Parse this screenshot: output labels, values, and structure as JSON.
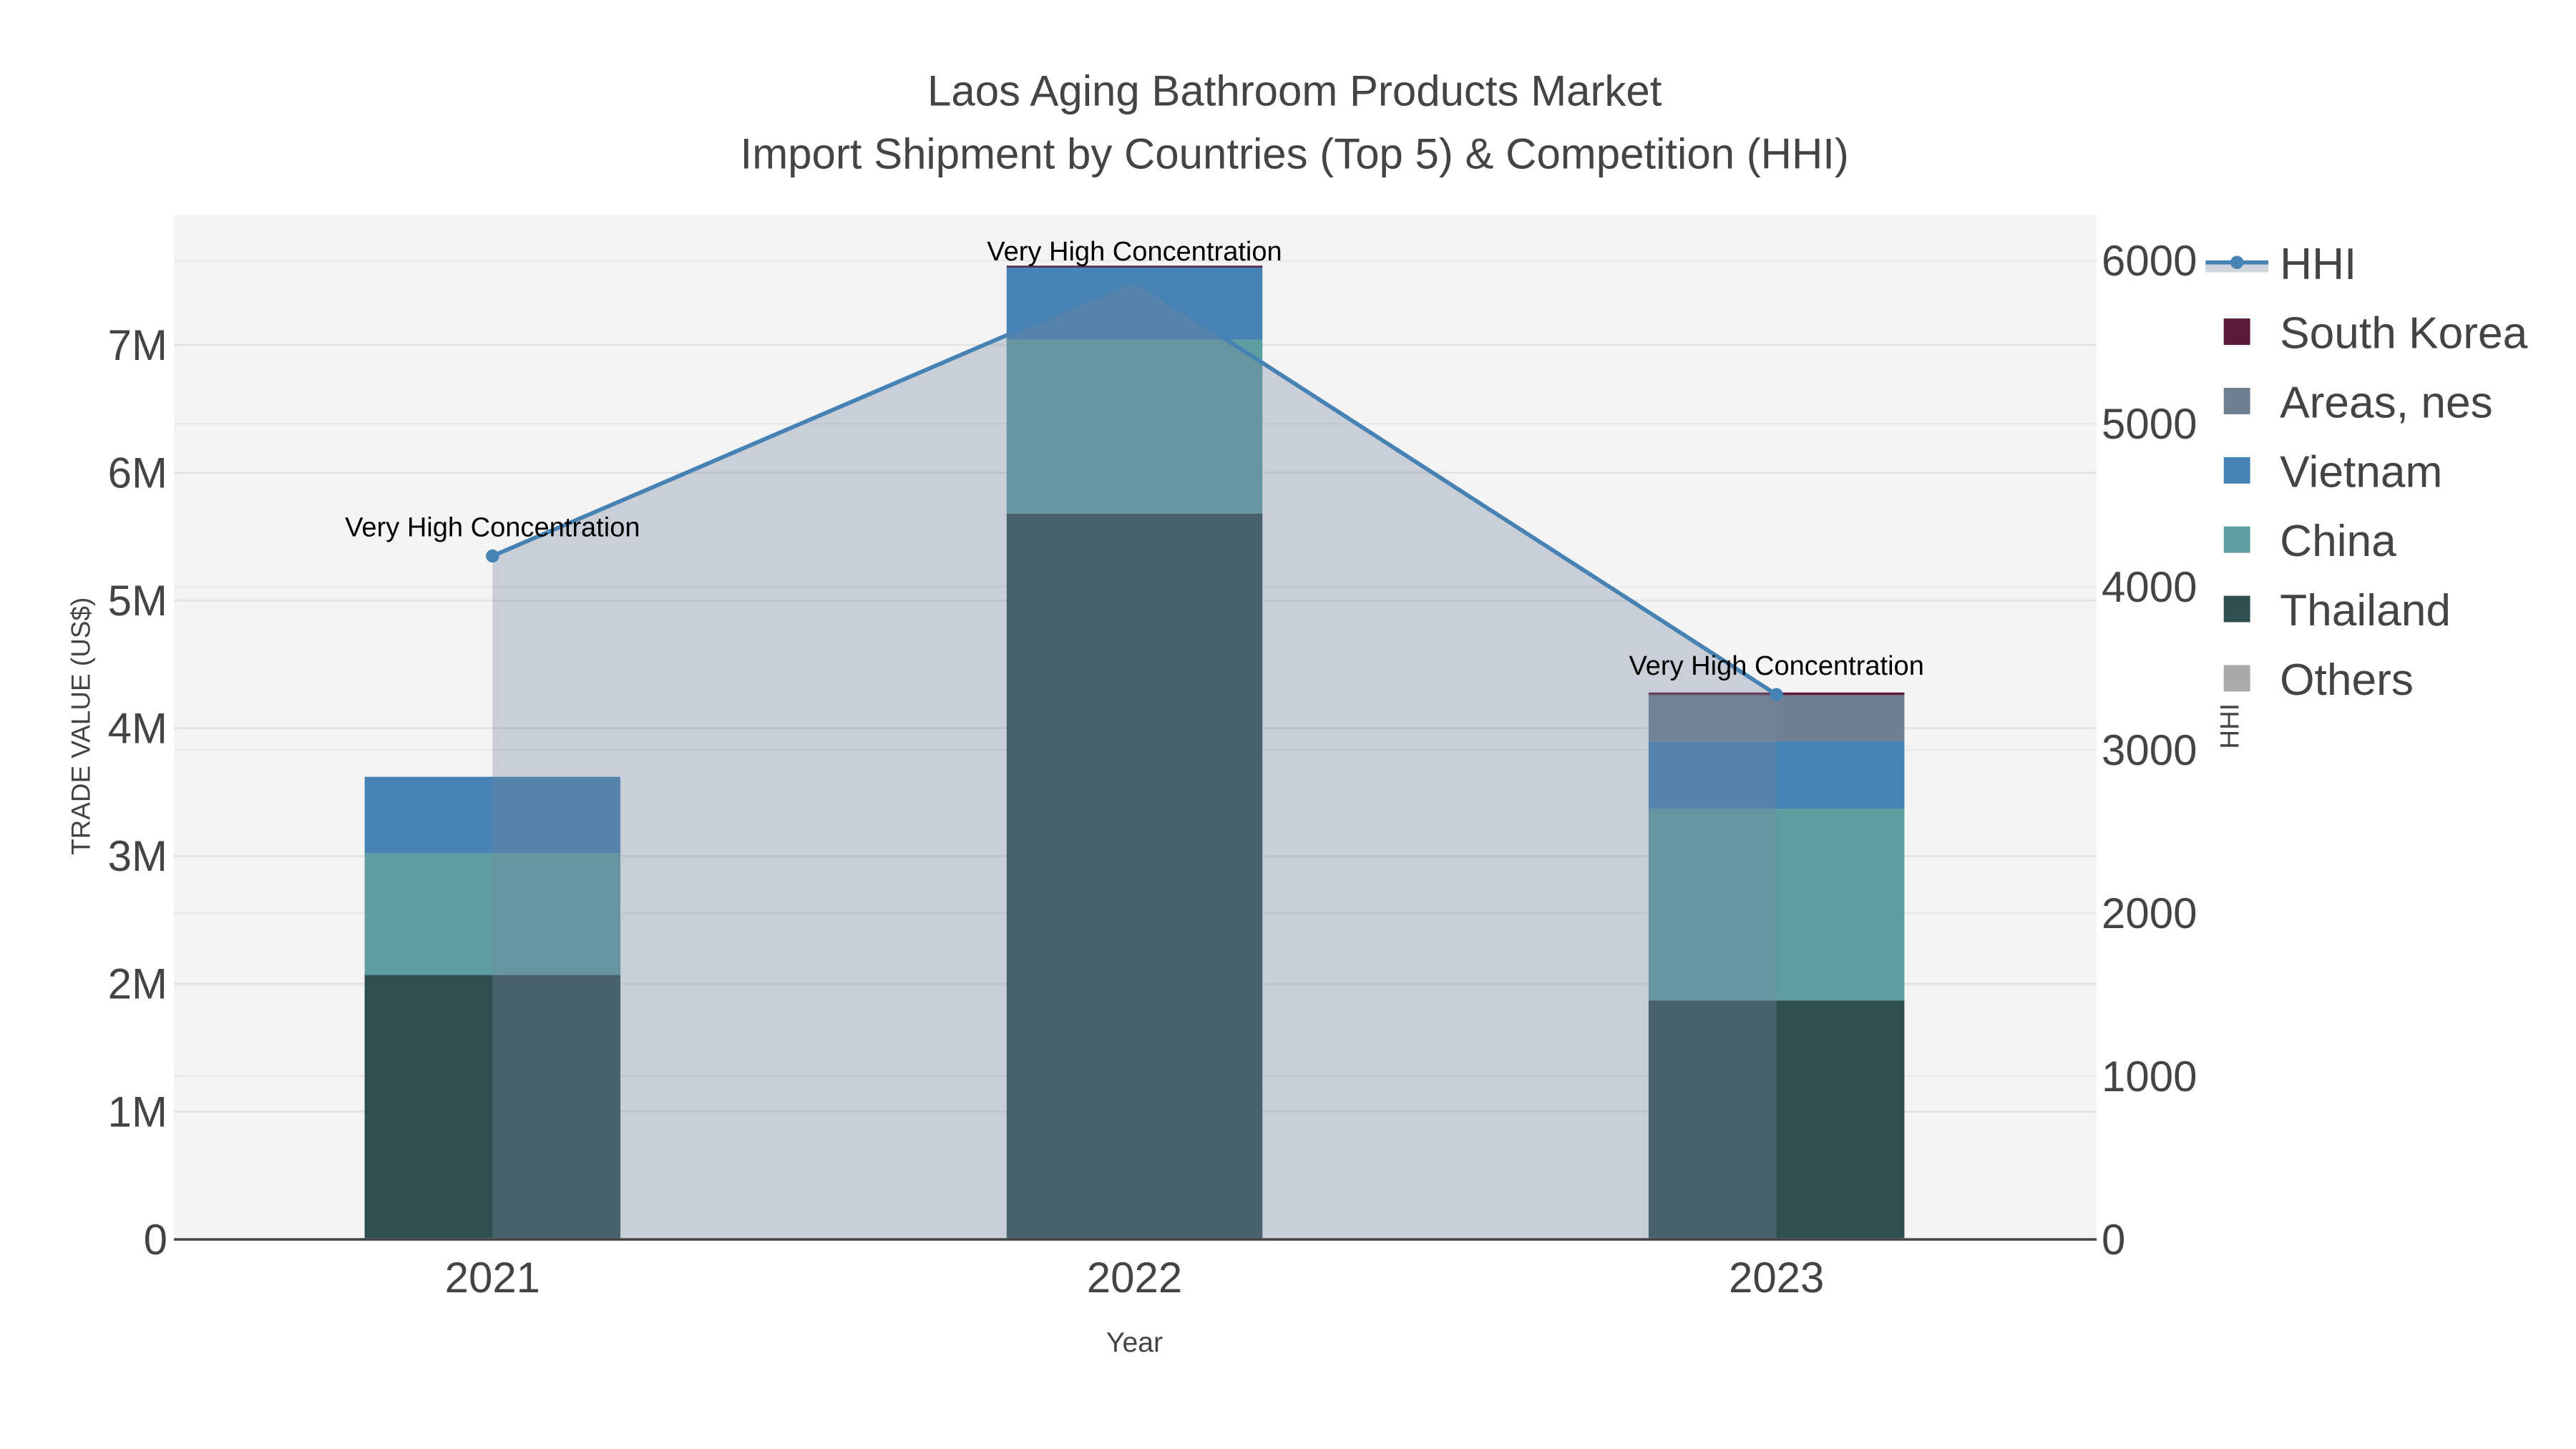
{
  "chart_data": {
    "type": "bar",
    "title": "Laos Aging Bathroom Products Market",
    "subtitle": "Import Shipment by Countries (Top 5) & Competition (HHI)",
    "xlabel": "Year",
    "ylabel": "TRADE VALUE (US$)",
    "y2label": "HHI",
    "categories": [
      "2021",
      "2022",
      "2023"
    ],
    "ylim": [
      0,
      7800000
    ],
    "y2lim": [
      0,
      6200
    ],
    "yticks": [
      0,
      1000000,
      2000000,
      3000000,
      4000000,
      5000000,
      6000000,
      7000000
    ],
    "yticklabels": [
      "0",
      "1M",
      "2M",
      "3M",
      "4M",
      "5M",
      "6M",
      "7M"
    ],
    "y2ticks": [
      0,
      1000,
      2000,
      3000,
      4000,
      5000,
      6000
    ],
    "y2ticklabels": [
      "0",
      "1000",
      "2000",
      "3000",
      "4000",
      "5000",
      "6000"
    ],
    "grid": true,
    "legend_placement": "right",
    "series": [
      {
        "name": "Others",
        "color": "#aaaaaa",
        "values": [
          10000,
          10000,
          10000
        ]
      },
      {
        "name": "Thailand",
        "color": "#2f4f4f",
        "values": [
          2060000,
          5670000,
          1860000
        ]
      },
      {
        "name": "China",
        "color": "#5f9ea0",
        "values": [
          950000,
          1360000,
          1500000
        ]
      },
      {
        "name": "Vietnam",
        "color": "#4682b4",
        "values": [
          600000,
          570000,
          530000
        ]
      },
      {
        "name": "Areas, nes",
        "color": "#708090",
        "values": [
          0,
          0,
          360000
        ]
      },
      {
        "name": "South Korea",
        "color": "#5c1a3a",
        "values": [
          0,
          10000,
          20000
        ]
      }
    ],
    "hhi": {
      "name": "HHI",
      "color": "#4682b4",
      "values": [
        4190,
        5880,
        3340
      ]
    },
    "annotations": [
      "Very High Concentration",
      "Very High Concentration",
      "Very High Concentration"
    ],
    "legend_order": [
      "HHI",
      "South Korea",
      "Areas, nes",
      "Vietnam",
      "China",
      "Thailand",
      "Others"
    ]
  }
}
